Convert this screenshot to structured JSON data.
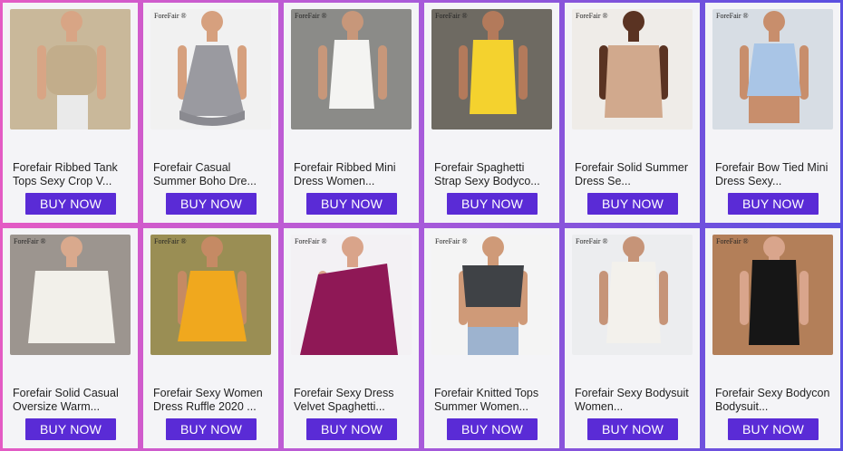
{
  "products": [
    {
      "title": "Forefair Ribbed Tank Tops Sexy Crop V...",
      "brand": "",
      "cta": "BUY NOW",
      "bg": "#c9b89a",
      "main": "#c2ad8b",
      "skin": "#d8a585"
    },
    {
      "title": "Forefair Casual Summer Boho Dre...",
      "brand": "ForeFair ®",
      "cta": "BUY NOW",
      "bg": "#f1f1f1",
      "main": "#9a9aa0",
      "skin": "#d6a07e"
    },
    {
      "title": "Forefair Ribbed Mini Dress Women...",
      "brand": "ForeFair ®",
      "cta": "BUY NOW",
      "bg": "#8b8b88",
      "main": "#f4f4f2",
      "skin": "#c7977a"
    },
    {
      "title": "Forefair Spaghetti Strap Sexy Bodyco...",
      "brand": "ForeFair ®",
      "cta": "BUY NOW",
      "bg": "#6e6a62",
      "main": "#f4d22e",
      "skin": "#b37a5b"
    },
    {
      "title": "Forefair Solid Summer Dress Se...",
      "brand": "ForeFair ®",
      "cta": "BUY NOW",
      "bg": "#efece8",
      "main": "#d1a98d",
      "skin": "#5a3322"
    },
    {
      "title": "Forefair Bow Tied Mini Dress Sexy...",
      "brand": "ForeFair ®",
      "cta": "BUY NOW",
      "bg": "#d7dde4",
      "main": "#a9c5e6",
      "skin": "#c88e6c"
    },
    {
      "title": "Forefair Solid Casual Oversize Warm...",
      "brand": "ForeFair ®",
      "cta": "BUY NOW",
      "bg": "#9c958f",
      "main": "#f2f0ea",
      "skin": "#d9a98d"
    },
    {
      "title": "Forefair Sexy Women Dress Ruffle 2020 ...",
      "brand": "ForeFair ®",
      "cta": "BUY NOW",
      "bg": "#9a8e54",
      "main": "#f0a81e",
      "skin": "#c58a64"
    },
    {
      "title": "Forefair Sexy Dress Velvet Spaghetti...",
      "brand": "ForeFair ®",
      "cta": "BUY NOW",
      "bg": "#f3f1f4",
      "main": "#8f1856",
      "skin": "#d9a48a"
    },
    {
      "title": "Forefair Knitted Tops Summer Women...",
      "brand": "ForeFair ®",
      "cta": "BUY NOW",
      "bg": "#f4f4f4",
      "main": "#3f4246",
      "skin": "#cf9a78"
    },
    {
      "title": "Forefair Sexy Bodysuit Women...",
      "brand": "ForeFair ®",
      "cta": "BUY NOW",
      "bg": "#ecedef",
      "main": "#f3f1ec",
      "skin": "#c69478"
    },
    {
      "title": "Forefair Sexy Bodycon Bodysuit...",
      "brand": "ForeFair ®",
      "cta": "BUY NOW",
      "bg": "#b37f59",
      "main": "#161616",
      "skin": "#d9a58c"
    }
  ]
}
